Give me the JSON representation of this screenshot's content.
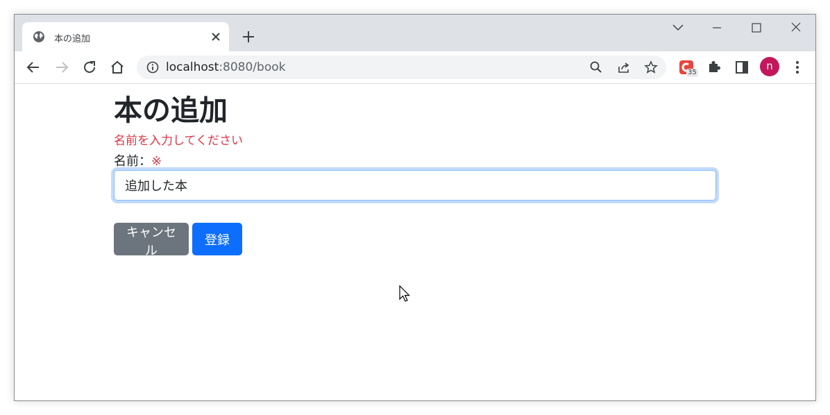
{
  "browser": {
    "tab_title": "本の追加",
    "url_host": "localhost",
    "url_port_path": ":8080/book",
    "extension_badge": "35",
    "avatar_letter": "n",
    "icons": {
      "favicon": "globe-icon",
      "tab_close": "close-icon",
      "new_tab": "plus-icon",
      "tab_search": "chevron-down-icon",
      "minimize": "minimize-icon",
      "maximize": "maximize-icon",
      "close": "close-icon",
      "back": "arrow-left-icon",
      "forward": "arrow-right-icon",
      "reload": "reload-icon",
      "home": "home-icon",
      "site_info": "info-icon",
      "zoom": "magnifier-icon",
      "share": "share-icon",
      "bookmark": "star-icon",
      "extensions": "puzzle-icon",
      "side_panel": "side-panel-icon",
      "menu": "kebab-menu-icon"
    },
    "colors": {
      "tabstrip": "#dee1e6",
      "omnibox": "#f1f3f4",
      "avatar": "#c2185b"
    }
  },
  "page": {
    "title": "本の追加",
    "error_message": "名前を入力してください",
    "name_label": "名前：",
    "required_mark": "※",
    "name_value": "追加した本",
    "cancel_label": "キャンセル",
    "submit_label": "登録",
    "colors": {
      "error": "#dc3545",
      "secondary_button": "#6c757d",
      "primary_button": "#0d6efd",
      "text": "#212529"
    }
  }
}
